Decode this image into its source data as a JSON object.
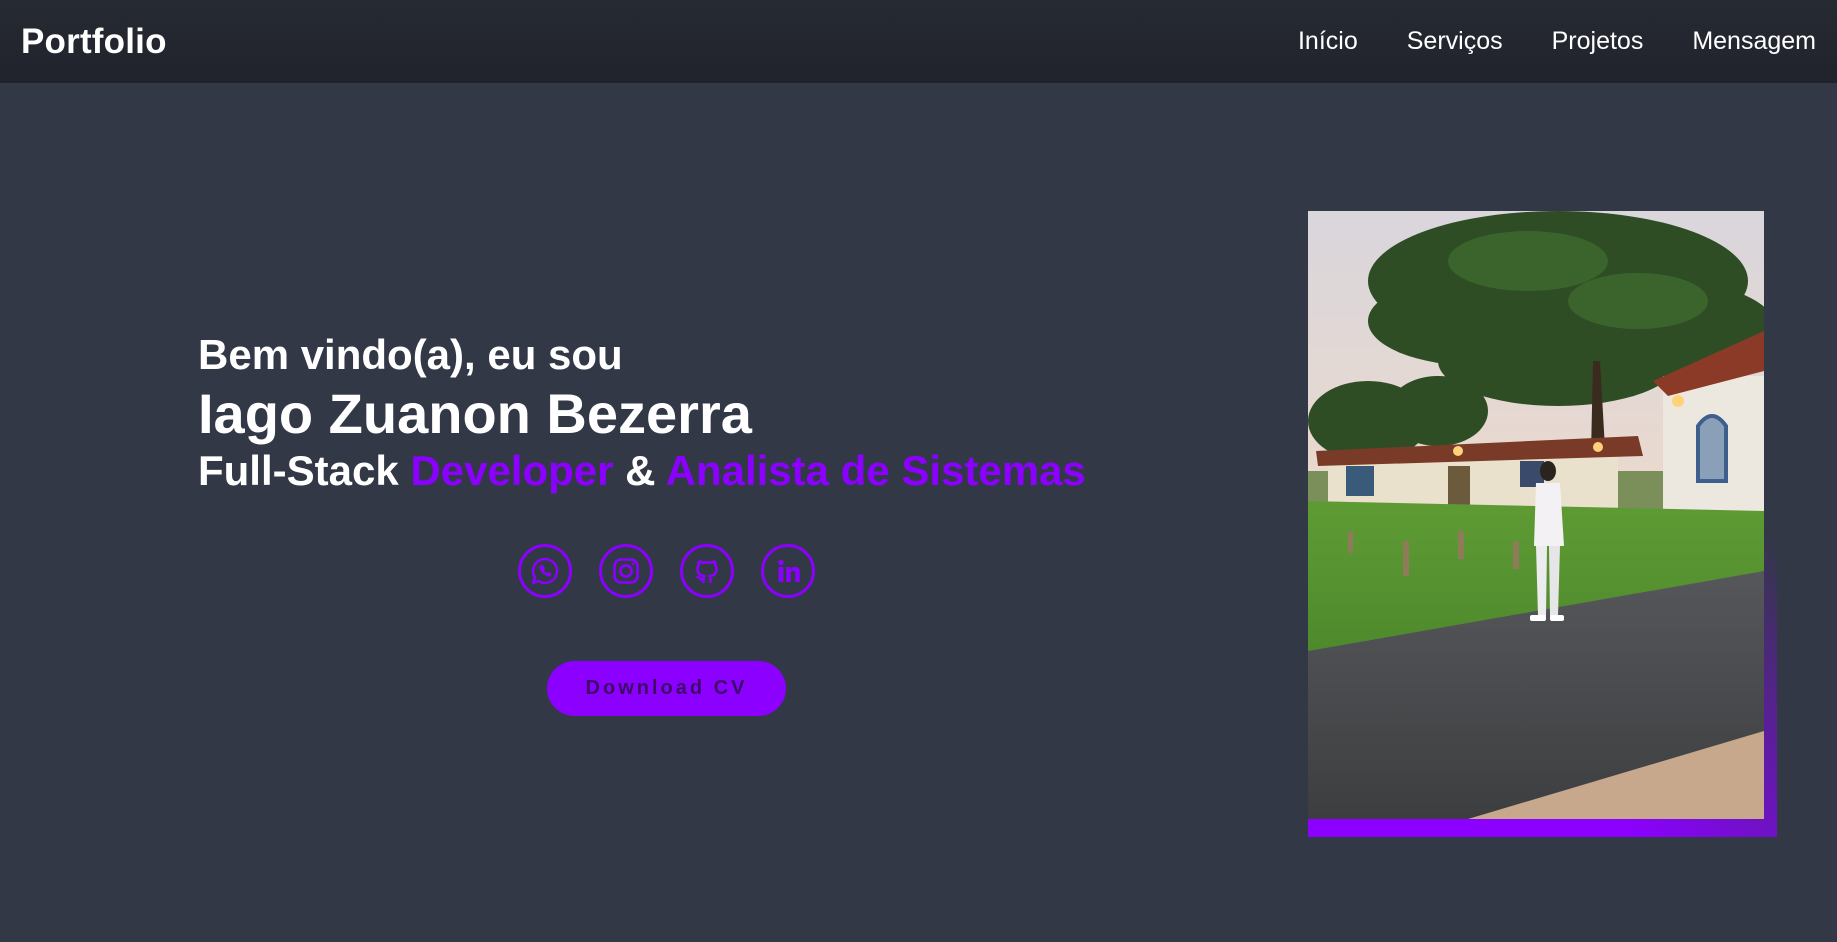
{
  "header": {
    "logo": "Portfolio",
    "nav": [
      {
        "label": "Início"
      },
      {
        "label": "Serviços"
      },
      {
        "label": "Projetos"
      },
      {
        "label": "Mensagem"
      }
    ]
  },
  "hero": {
    "greeting": "Bem vindo(a), eu sou",
    "name": "Iago Zuanon Bezerra",
    "role_prefix": "Full-Stack ",
    "role_accent1": "Developer",
    "role_mid": " & ",
    "role_accent2": "Analista de Sistemas",
    "socials": [
      {
        "icon": "whatsapp-icon"
      },
      {
        "icon": "instagram-icon"
      },
      {
        "icon": "github-icon"
      },
      {
        "icon": "linkedin-icon"
      }
    ],
    "cv_button": "Download CV"
  },
  "colors": {
    "accent": "#8b00ff",
    "background": "#323846",
    "header": "#20232b"
  }
}
